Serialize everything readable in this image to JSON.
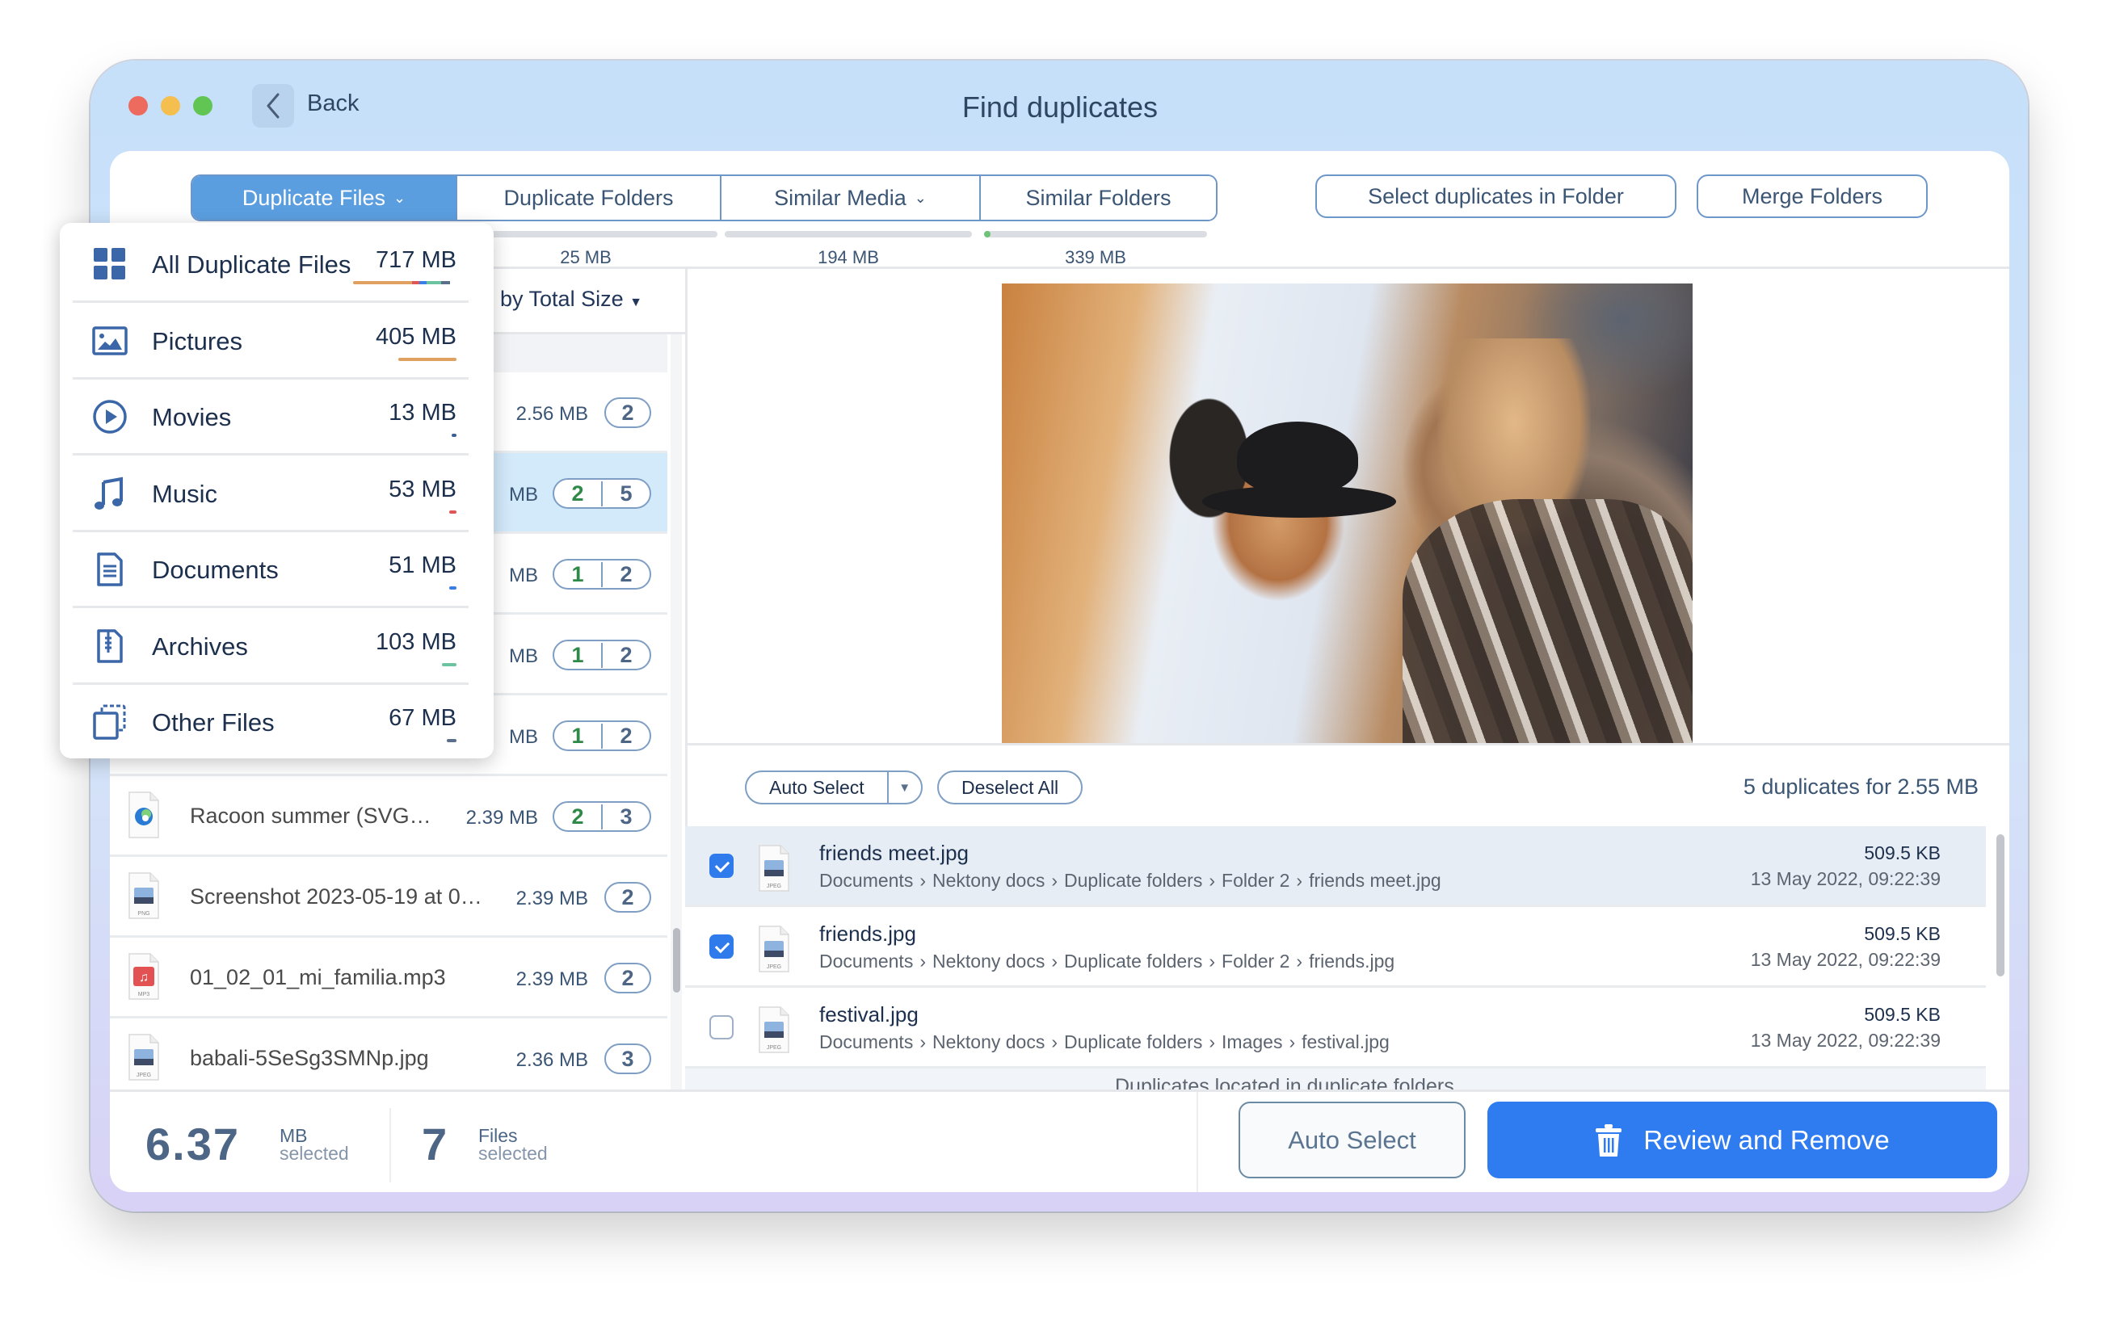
{
  "window": {
    "title": "Find duplicates",
    "back_label": "Back"
  },
  "tabs": [
    {
      "label": "Duplicate Files",
      "has_chevron": true,
      "active": true,
      "size": ""
    },
    {
      "label": "Duplicate Folders",
      "has_chevron": false,
      "active": false,
      "size": "25 MB",
      "progress": 0
    },
    {
      "label": "Similar Media",
      "has_chevron": true,
      "active": false,
      "size": "194 MB",
      "progress": 0
    },
    {
      "label": "Similar Folders",
      "has_chevron": false,
      "active": false,
      "size": "339 MB",
      "progress": 0.02
    }
  ],
  "toolbar": {
    "select_in_folder": "Select duplicates in Folder",
    "merge_folders": "Merge Folders"
  },
  "sort": {
    "label": "by Total Size"
  },
  "file_list": [
    {
      "name": "",
      "size": "2.56 MB",
      "counts": [
        "2"
      ],
      "selected_count": null,
      "icon": "file-icon",
      "selected": false
    },
    {
      "name": "",
      "size": "MB",
      "counts": [
        "2",
        "5"
      ],
      "selected_count": "2",
      "icon": "file-icon",
      "selected": true
    },
    {
      "name": "",
      "size": "MB",
      "counts": [
        "1",
        "2"
      ],
      "selected_count": "1",
      "icon": "file-icon",
      "selected": false
    },
    {
      "name": "",
      "size": "MB",
      "counts": [
        "1",
        "2"
      ],
      "selected_count": "1",
      "icon": "file-icon",
      "selected": false
    },
    {
      "name": "",
      "size": "MB",
      "counts": [
        "1",
        "2"
      ],
      "selected_count": "1",
      "icon": "file-icon",
      "selected": false
    },
    {
      "name": "Racoon summer (SVG…",
      "size": "2.39 MB",
      "counts": [
        "2",
        "3"
      ],
      "selected_count": "2",
      "icon": "edge-svg-icon",
      "selected": false
    },
    {
      "name": "Screenshot 2023-05-19 at 0…",
      "size": "2.39 MB",
      "counts": [
        "2"
      ],
      "selected_count": null,
      "icon": "png-file-icon",
      "file_type": "PNG",
      "selected": false
    },
    {
      "name": "01_02_01_mi_familia.mp3",
      "size": "2.39 MB",
      "counts": [
        "2"
      ],
      "selected_count": null,
      "icon": "mp3-file-icon",
      "file_type": "MP3",
      "selected": false
    },
    {
      "name": "babali-5SeSg3SMNp.jpg",
      "size": "2.36 MB",
      "counts": [
        "3"
      ],
      "selected_count": null,
      "icon": "jpeg-file-icon",
      "file_type": "JPEG",
      "selected": false
    }
  ],
  "category_menu": [
    {
      "label": "All Duplicate Files",
      "size": "717 MB",
      "icon": "grid-icon",
      "bar": [
        {
          "color": "#e0a060",
          "share": 0.57
        },
        {
          "color": "#e05555",
          "share": 0.07
        },
        {
          "color": "#3a7ee8",
          "share": 0.07
        },
        {
          "color": "#6cc3a0",
          "share": 0.14
        },
        {
          "color": "#5a6f8a",
          "share": 0.09
        }
      ]
    },
    {
      "label": "Pictures",
      "size": "405 MB",
      "icon": "picture-icon",
      "bar": [
        {
          "color": "#e0a060",
          "share": 1
        }
      ]
    },
    {
      "label": "Movies",
      "size": "13 MB",
      "icon": "play-circle-icon",
      "bar": [
        {
          "color": "#3a5f9a",
          "share": 1
        }
      ]
    },
    {
      "label": "Music",
      "size": "53 MB",
      "icon": "music-note-icon",
      "bar": [
        {
          "color": "#e05555",
          "share": 1
        }
      ]
    },
    {
      "label": "Documents",
      "size": "51 MB",
      "icon": "document-icon",
      "bar": [
        {
          "color": "#3a7ee8",
          "share": 1
        }
      ]
    },
    {
      "label": "Archives",
      "size": "103 MB",
      "icon": "archive-icon",
      "bar": [
        {
          "color": "#6cc3a0",
          "share": 1
        }
      ]
    },
    {
      "label": "Other Files",
      "size": "67 MB",
      "icon": "other-files-icon",
      "bar": [
        {
          "color": "#5a6f8a",
          "share": 1
        }
      ]
    }
  ],
  "selection_bar": {
    "auto_select": "Auto Select",
    "deselect_all": "Deselect All",
    "summary": "5 duplicates for 2.55 MB"
  },
  "duplicates": [
    {
      "name": "friends meet.jpg",
      "path": [
        "Documents",
        "Nektony docs",
        "Duplicate folders",
        "Folder 2",
        "friends meet.jpg"
      ],
      "size": "509.5 KB",
      "date": "13 May 2022, 09:22:39",
      "checked": true,
      "highlighted": true,
      "file_type": "JPEG"
    },
    {
      "name": "friends.jpg",
      "path": [
        "Documents",
        "Nektony docs",
        "Duplicate folders",
        "Folder 2",
        "friends.jpg"
      ],
      "size": "509.5 KB",
      "date": "13 May 2022, 09:22:39",
      "checked": true,
      "highlighted": false,
      "file_type": "JPEG"
    },
    {
      "name": "festival.jpg",
      "path": [
        "Documents",
        "Nektony docs",
        "Duplicate folders",
        "Images",
        "festival.jpg"
      ],
      "size": "509.5 KB",
      "date": "13 May 2022, 09:22:39",
      "checked": false,
      "highlighted": false,
      "file_type": "JPEG"
    }
  ],
  "duplicates_group_label": "Duplicates located in duplicate folders",
  "footer": {
    "size_value": "6.37",
    "size_unit": "MB",
    "size_caption": "selected",
    "files_value": "7",
    "files_unit": "Files",
    "files_caption": "selected",
    "auto_select": "Auto Select",
    "review_remove": "Review and Remove"
  },
  "colors": {
    "accent": "#2f7bf0",
    "active_tab": "#5b9ee0",
    "selected_row": "#d3eafb",
    "green_count": "#2f8a4a"
  }
}
